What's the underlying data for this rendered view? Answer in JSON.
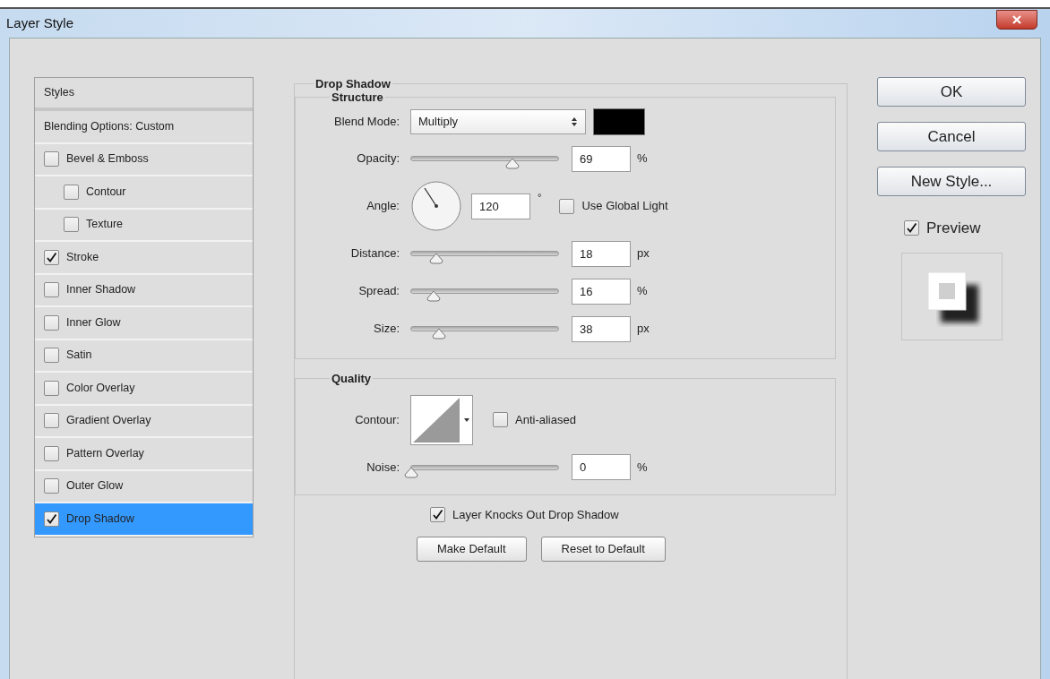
{
  "window": {
    "title": "Layer Style"
  },
  "styles_panel": {
    "header": "Styles",
    "items": [
      {
        "label": "Blending Options: Custom",
        "kind": "option",
        "selected": false
      },
      {
        "label": "Bevel & Emboss",
        "kind": "checkbox",
        "checked": false,
        "selected": false,
        "children": [
          {
            "label": "Contour",
            "kind": "checkbox",
            "checked": false,
            "selected": false
          },
          {
            "label": "Texture",
            "kind": "checkbox",
            "checked": false,
            "selected": false
          }
        ]
      },
      {
        "label": "Stroke",
        "kind": "checkbox",
        "checked": true,
        "selected": false
      },
      {
        "label": "Inner Shadow",
        "kind": "checkbox",
        "checked": false,
        "selected": false
      },
      {
        "label": "Inner Glow",
        "kind": "checkbox",
        "checked": false,
        "selected": false
      },
      {
        "label": "Satin",
        "kind": "checkbox",
        "checked": false,
        "selected": false
      },
      {
        "label": "Color Overlay",
        "kind": "checkbox",
        "checked": false,
        "selected": false
      },
      {
        "label": "Gradient Overlay",
        "kind": "checkbox",
        "checked": false,
        "selected": false
      },
      {
        "label": "Pattern Overlay",
        "kind": "checkbox",
        "checked": false,
        "selected": false
      },
      {
        "label": "Outer Glow",
        "kind": "checkbox",
        "checked": false,
        "selected": false
      },
      {
        "label": "Drop Shadow",
        "kind": "checkbox",
        "checked": true,
        "selected": true
      }
    ]
  },
  "settings": {
    "title": "Drop Shadow",
    "structure": {
      "title": "Structure",
      "rows": [
        {
          "kind": "select",
          "label": "Blend Mode:",
          "value": "Multiply",
          "color": "#000000"
        },
        {
          "kind": "slider",
          "label": "Opacity:",
          "level": 0.69,
          "value": "69",
          "unit": "%"
        },
        {
          "kind": "angle",
          "label": "Angle:",
          "value": "120",
          "unit": "°",
          "checkbox": {
            "label": "Use Global Light",
            "checked": false
          }
        },
        {
          "kind": "slider",
          "label": "Distance:",
          "level": 0.17,
          "value": "18",
          "unit": "px"
        },
        {
          "kind": "slider",
          "label": "Spread:",
          "level": 0.15,
          "value": "16",
          "unit": "%"
        },
        {
          "kind": "slider",
          "label": "Size:",
          "level": 0.19,
          "value": "38",
          "unit": "px"
        }
      ]
    },
    "quality": {
      "title": "Quality",
      "rows": [
        {
          "kind": "contour",
          "label": "Contour:",
          "checkbox": {
            "label": "Anti-aliased",
            "checked": false
          }
        },
        {
          "kind": "slider",
          "label": "Noise:",
          "level": 0,
          "value": "0",
          "unit": "%"
        }
      ]
    },
    "knockout": {
      "label": "Layer Knocks Out Drop Shadow",
      "checked": true
    },
    "buttons": [
      "Make Default",
      "Reset to Default"
    ]
  },
  "actions": {
    "buttons": [
      "OK",
      "Cancel",
      "New Style..."
    ],
    "preview": {
      "label": "Preview",
      "checked": true
    }
  }
}
